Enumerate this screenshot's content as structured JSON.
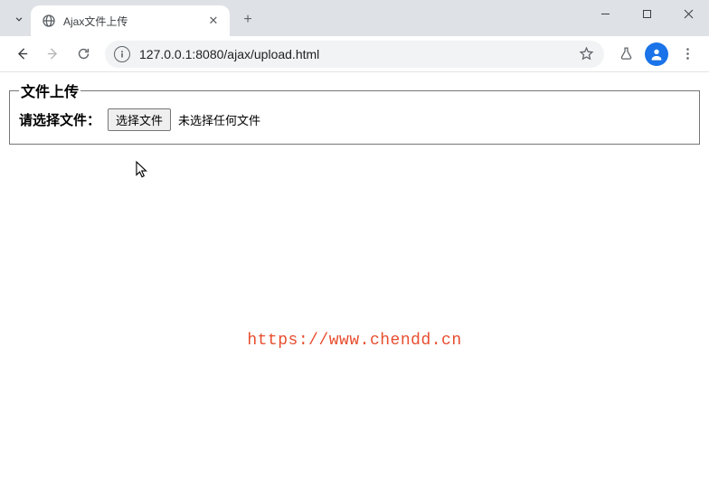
{
  "browser": {
    "tab_title": "Ajax文件上传",
    "url": "127.0.0.1:8080/ajax/upload.html"
  },
  "page": {
    "legend": "文件上传",
    "select_label": "请选择文件：",
    "choose_button": "选择文件",
    "no_file_text": "未选择任何文件"
  },
  "watermark": {
    "text": "https://www.chendd.cn"
  }
}
